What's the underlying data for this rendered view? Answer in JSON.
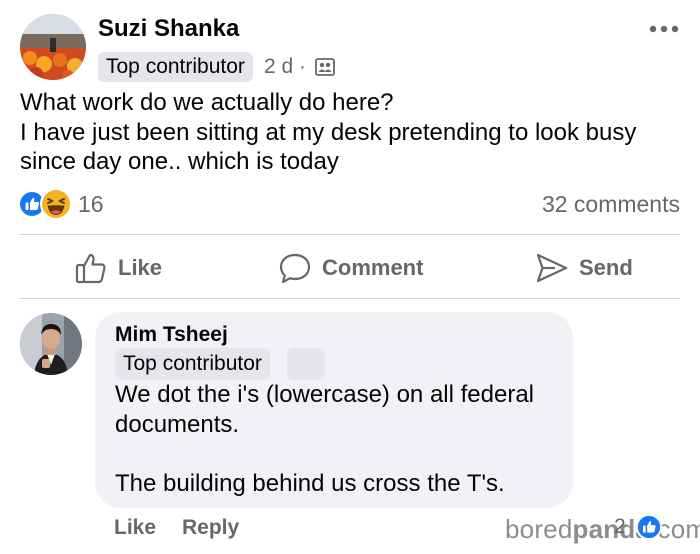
{
  "post": {
    "author": "Suzi Shanka",
    "badge": "Top contributor",
    "time": "2 d ·",
    "audience_icon": "group-audience-icon",
    "text_lines": [
      "What work do we actually do here?",
      "I have just been sitting at my desk pretending to look busy",
      "since day one.. which is today"
    ],
    "reactions": [
      "like-reaction-icon",
      "haha-reaction-icon"
    ],
    "reaction_count": "16",
    "comment_count": "32 comments"
  },
  "actions": {
    "like": "Like",
    "comment": "Comment",
    "send": "Send"
  },
  "comment": {
    "author": "Mim Tsheej",
    "badge": "Top contributor",
    "text_lines": [
      "We dot the i's (lowercase) on all federal",
      "documents.",
      "",
      "The building behind us cross the T's."
    ],
    "like": "Like",
    "reply": "Reply",
    "reaction_count": "2"
  },
  "watermark": {
    "part1": "bored",
    "part2": "panda",
    "part3": ".com"
  },
  "colors": {
    "text_primary": "#050505",
    "text_secondary": "#65676b",
    "badge_bg": "#e4e6eb",
    "bubble_bg": "#f0f2f5",
    "like_blue": "#1877f2",
    "haha_yellow": "#f7b125"
  }
}
